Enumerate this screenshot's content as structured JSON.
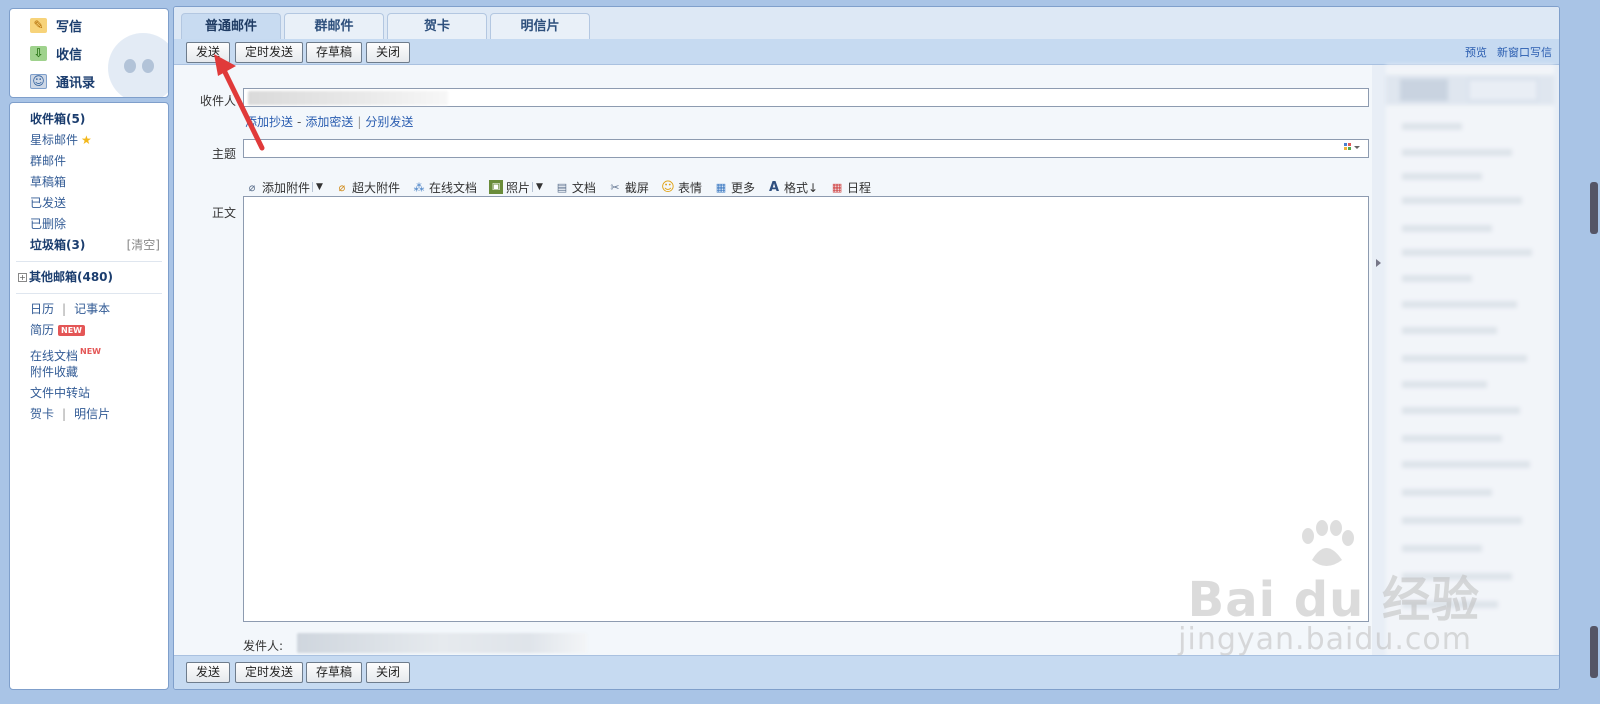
{
  "sidebar": {
    "quick": [
      {
        "label": "写信",
        "icon": "pencil-icon"
      },
      {
        "label": "收信",
        "icon": "inbox-download-icon"
      },
      {
        "label": "通讯录",
        "icon": "address-book-icon"
      }
    ],
    "folders": [
      {
        "label": "收件箱(5)",
        "bold": true
      },
      {
        "label": "星标邮件",
        "star": true
      },
      {
        "label": "群邮件"
      },
      {
        "label": "草稿箱"
      },
      {
        "label": "已发送"
      },
      {
        "label": "已删除"
      },
      {
        "label": "垃圾箱(3)",
        "bold": true,
        "clear": "[清空]"
      }
    ],
    "other_mail": "其他邮箱(480)",
    "expand_symbol": "+",
    "tools": {
      "calendar": "日历",
      "notebook": "记事本",
      "resume": "简历",
      "resume_badge": "NEW",
      "online_docs": "在线文档",
      "online_docs_badge": "NEW",
      "attachments": "附件收藏",
      "file_transfer": "文件中转站",
      "greeting_card": "贺卡",
      "postcard": "明信片",
      "pipe": "|"
    }
  },
  "tabs": [
    "普通邮件",
    "群邮件",
    "贺卡",
    "明信片"
  ],
  "toolbar": {
    "send": "发送",
    "scheduled_send": "定时发送",
    "save_draft": "存草稿",
    "close": "关闭",
    "preview": "预览",
    "new_window": "新窗口写信"
  },
  "compose": {
    "to_label": "收件人",
    "add_cc": "添加抄送",
    "add_bcc": "添加密送",
    "separate_send": "分别发送",
    "dash": "-",
    "pipe": "|",
    "subject_label": "主题",
    "body_label": "正文",
    "from_label": "发件人:"
  },
  "format_bar": {
    "add_attachment": "添加附件",
    "large_attachment": "超大附件",
    "online_doc": "在线文档",
    "photo": "照片",
    "document": "文档",
    "screenshot": "截屏",
    "emoji": "表情",
    "more": "更多",
    "format": "格式↓",
    "schedule": "日程"
  },
  "colors": {
    "accent": "#2a5db0",
    "toolbar": "#c6daf1",
    "arrow": "#e03a3a"
  },
  "watermark": {
    "brand": "Bai du 经验",
    "url": "jingyan.baidu.com"
  }
}
